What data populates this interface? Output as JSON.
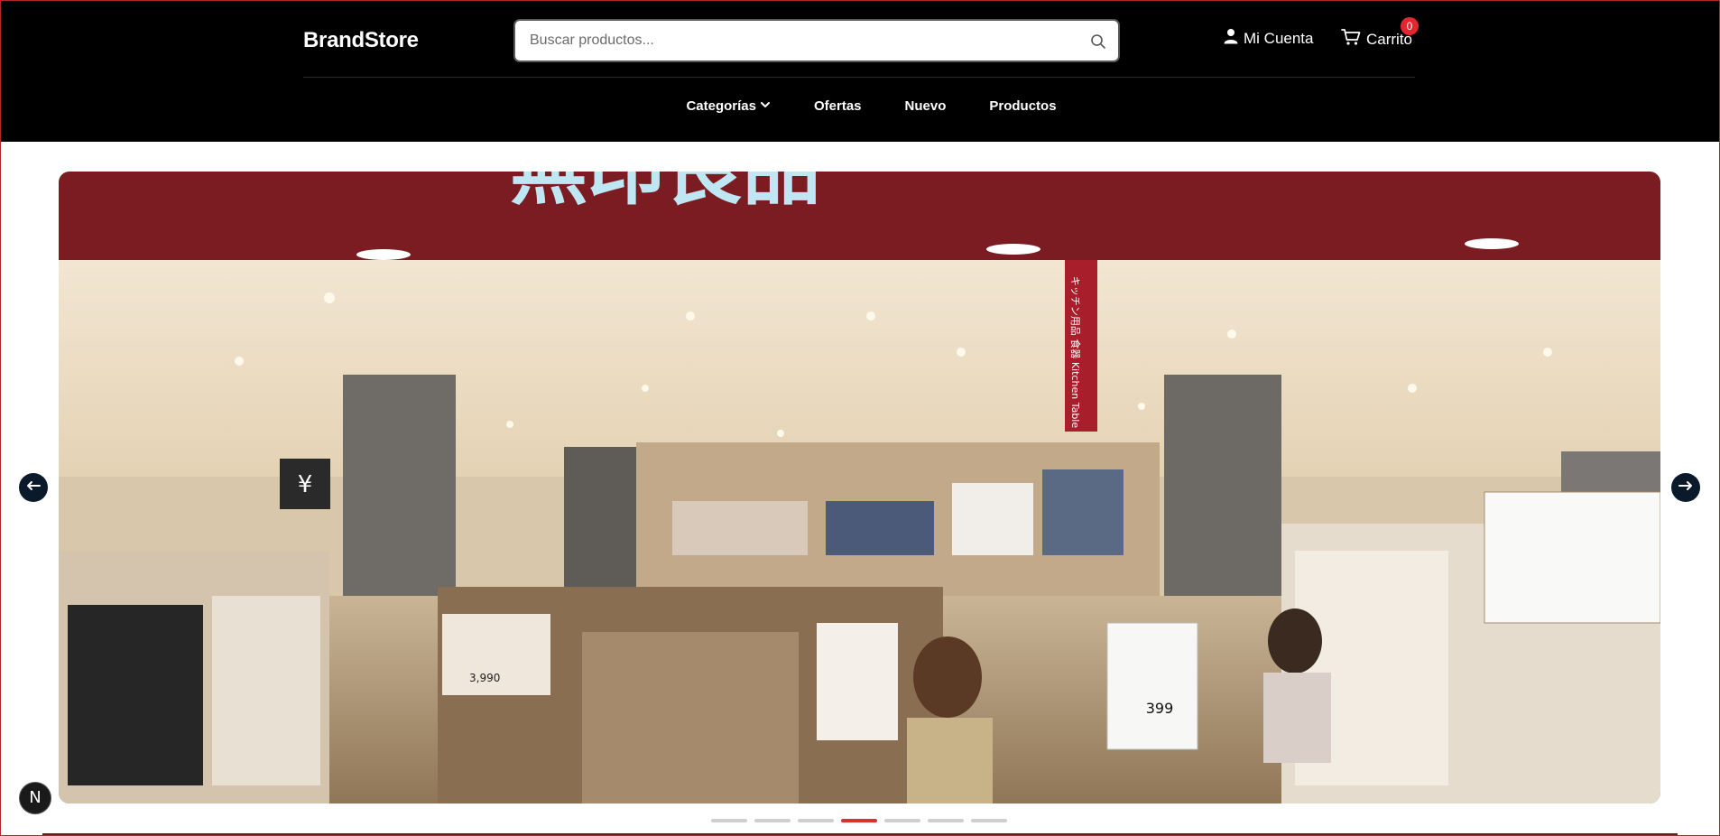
{
  "header": {
    "brand": "BrandStore",
    "search_placeholder": "Buscar productos...",
    "account_label": "Mi Cuenta",
    "cart_label": "Carrito",
    "cart_count": "0"
  },
  "nav": {
    "items": [
      {
        "label": "Categorías"
      },
      {
        "label": "Ofertas"
      },
      {
        "label": "Nuevo"
      },
      {
        "label": "Productos"
      }
    ]
  },
  "hero": {
    "slide_count": 7,
    "active_index": 3,
    "image_signs": {
      "banner": "無印良品",
      "kitchen_sign": "キッチン用品 食器 Kitchen Table",
      "price_tag": "399",
      "left_tag": "3,990",
      "yen_sign": "¥"
    }
  },
  "floating_button": {
    "label": "N"
  },
  "colors": {
    "header_bg": "#000000",
    "badge": "#e3262f",
    "active_dot": "#d9322f",
    "arrow_bg": "#0b1a2a"
  },
  "icons": {
    "search": "search-icon",
    "account": "user-icon",
    "cart": "cart-icon",
    "chevron": "chevron-down-icon",
    "prev": "arrow-left-icon",
    "next": "arrow-right-icon"
  }
}
